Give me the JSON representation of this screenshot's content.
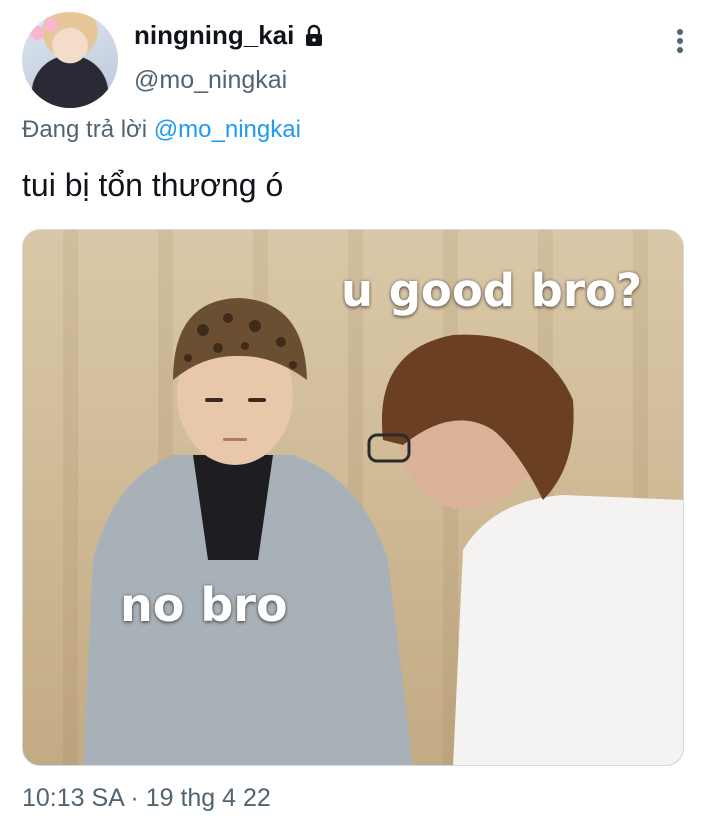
{
  "tweet": {
    "display_name": "ningning_kai",
    "handle": "@mo_ningkai",
    "reply_prefix": "Đang trả lời",
    "reply_to": "@mo_ningkai",
    "text": "tui bị tổn thương ó",
    "timestamp": "10:13 SA · 19 thg 4 22",
    "media": {
      "caption_top": "u good bro?",
      "caption_bottom": "no bro"
    }
  },
  "icons": {
    "protected": "lock-icon",
    "menu": "more-vertical-icon"
  },
  "colors": {
    "text": "#0f1419",
    "secondary": "#536471",
    "link": "#1d9bf0"
  }
}
